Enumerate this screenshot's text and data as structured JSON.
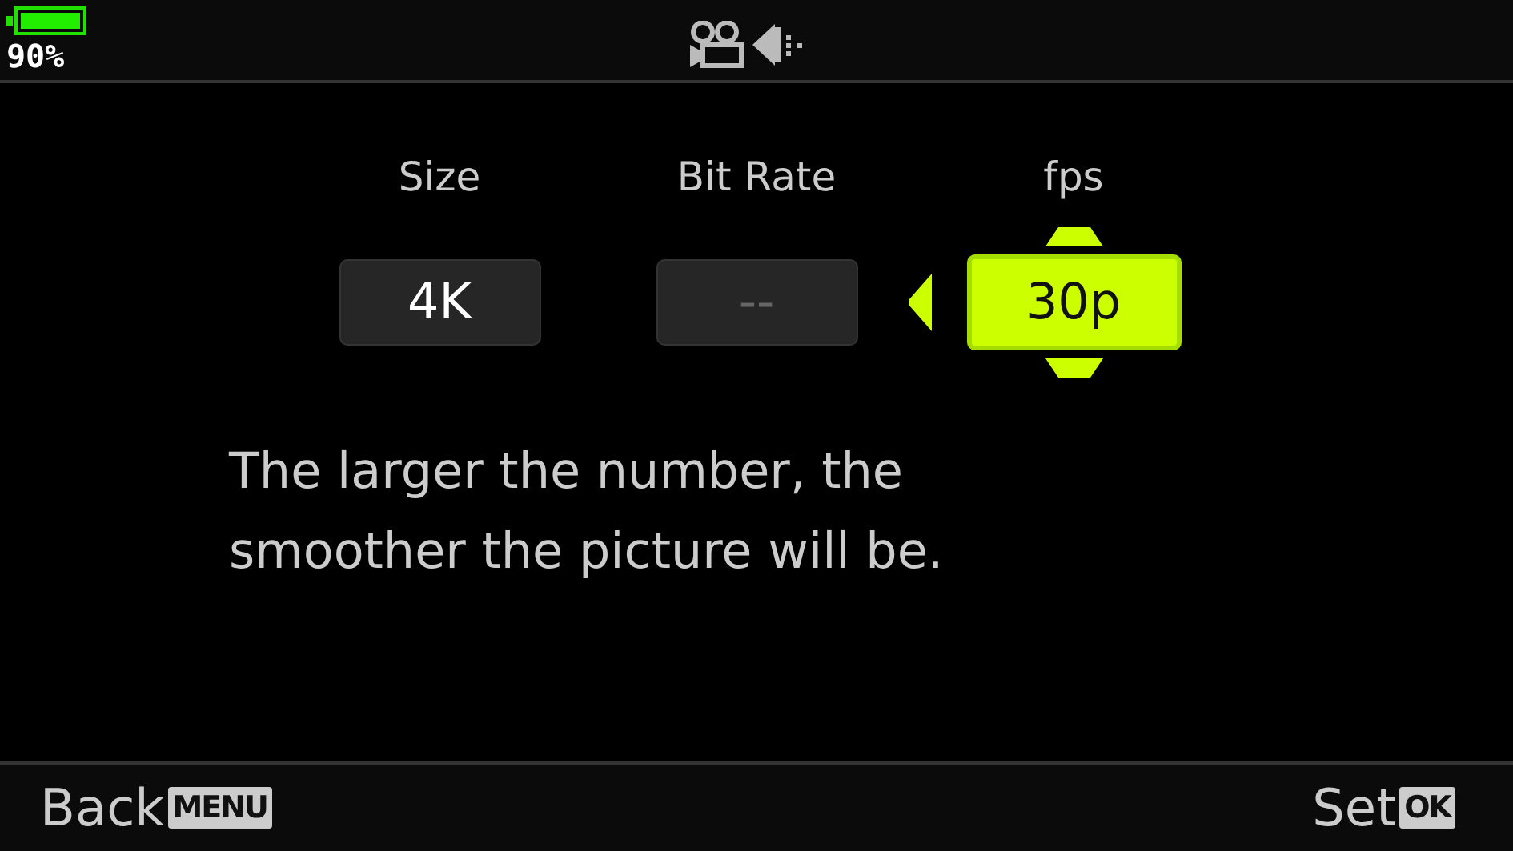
{
  "status_bar": {
    "battery": "90%"
  },
  "settings": [
    {
      "label": "Size",
      "value": "4K",
      "selected": false,
      "disabled": false
    },
    {
      "label": "Bit Rate",
      "value": "--",
      "selected": false,
      "disabled": true
    },
    {
      "label": "fps",
      "value": "30p",
      "selected": true,
      "disabled": false
    }
  ],
  "description": [
    "The larger the number, the",
    "smoother the picture will be."
  ],
  "footer": [
    {
      "label": "Back",
      "key": "MENU"
    },
    {
      "label": "Set",
      "key": "OK"
    }
  ]
}
